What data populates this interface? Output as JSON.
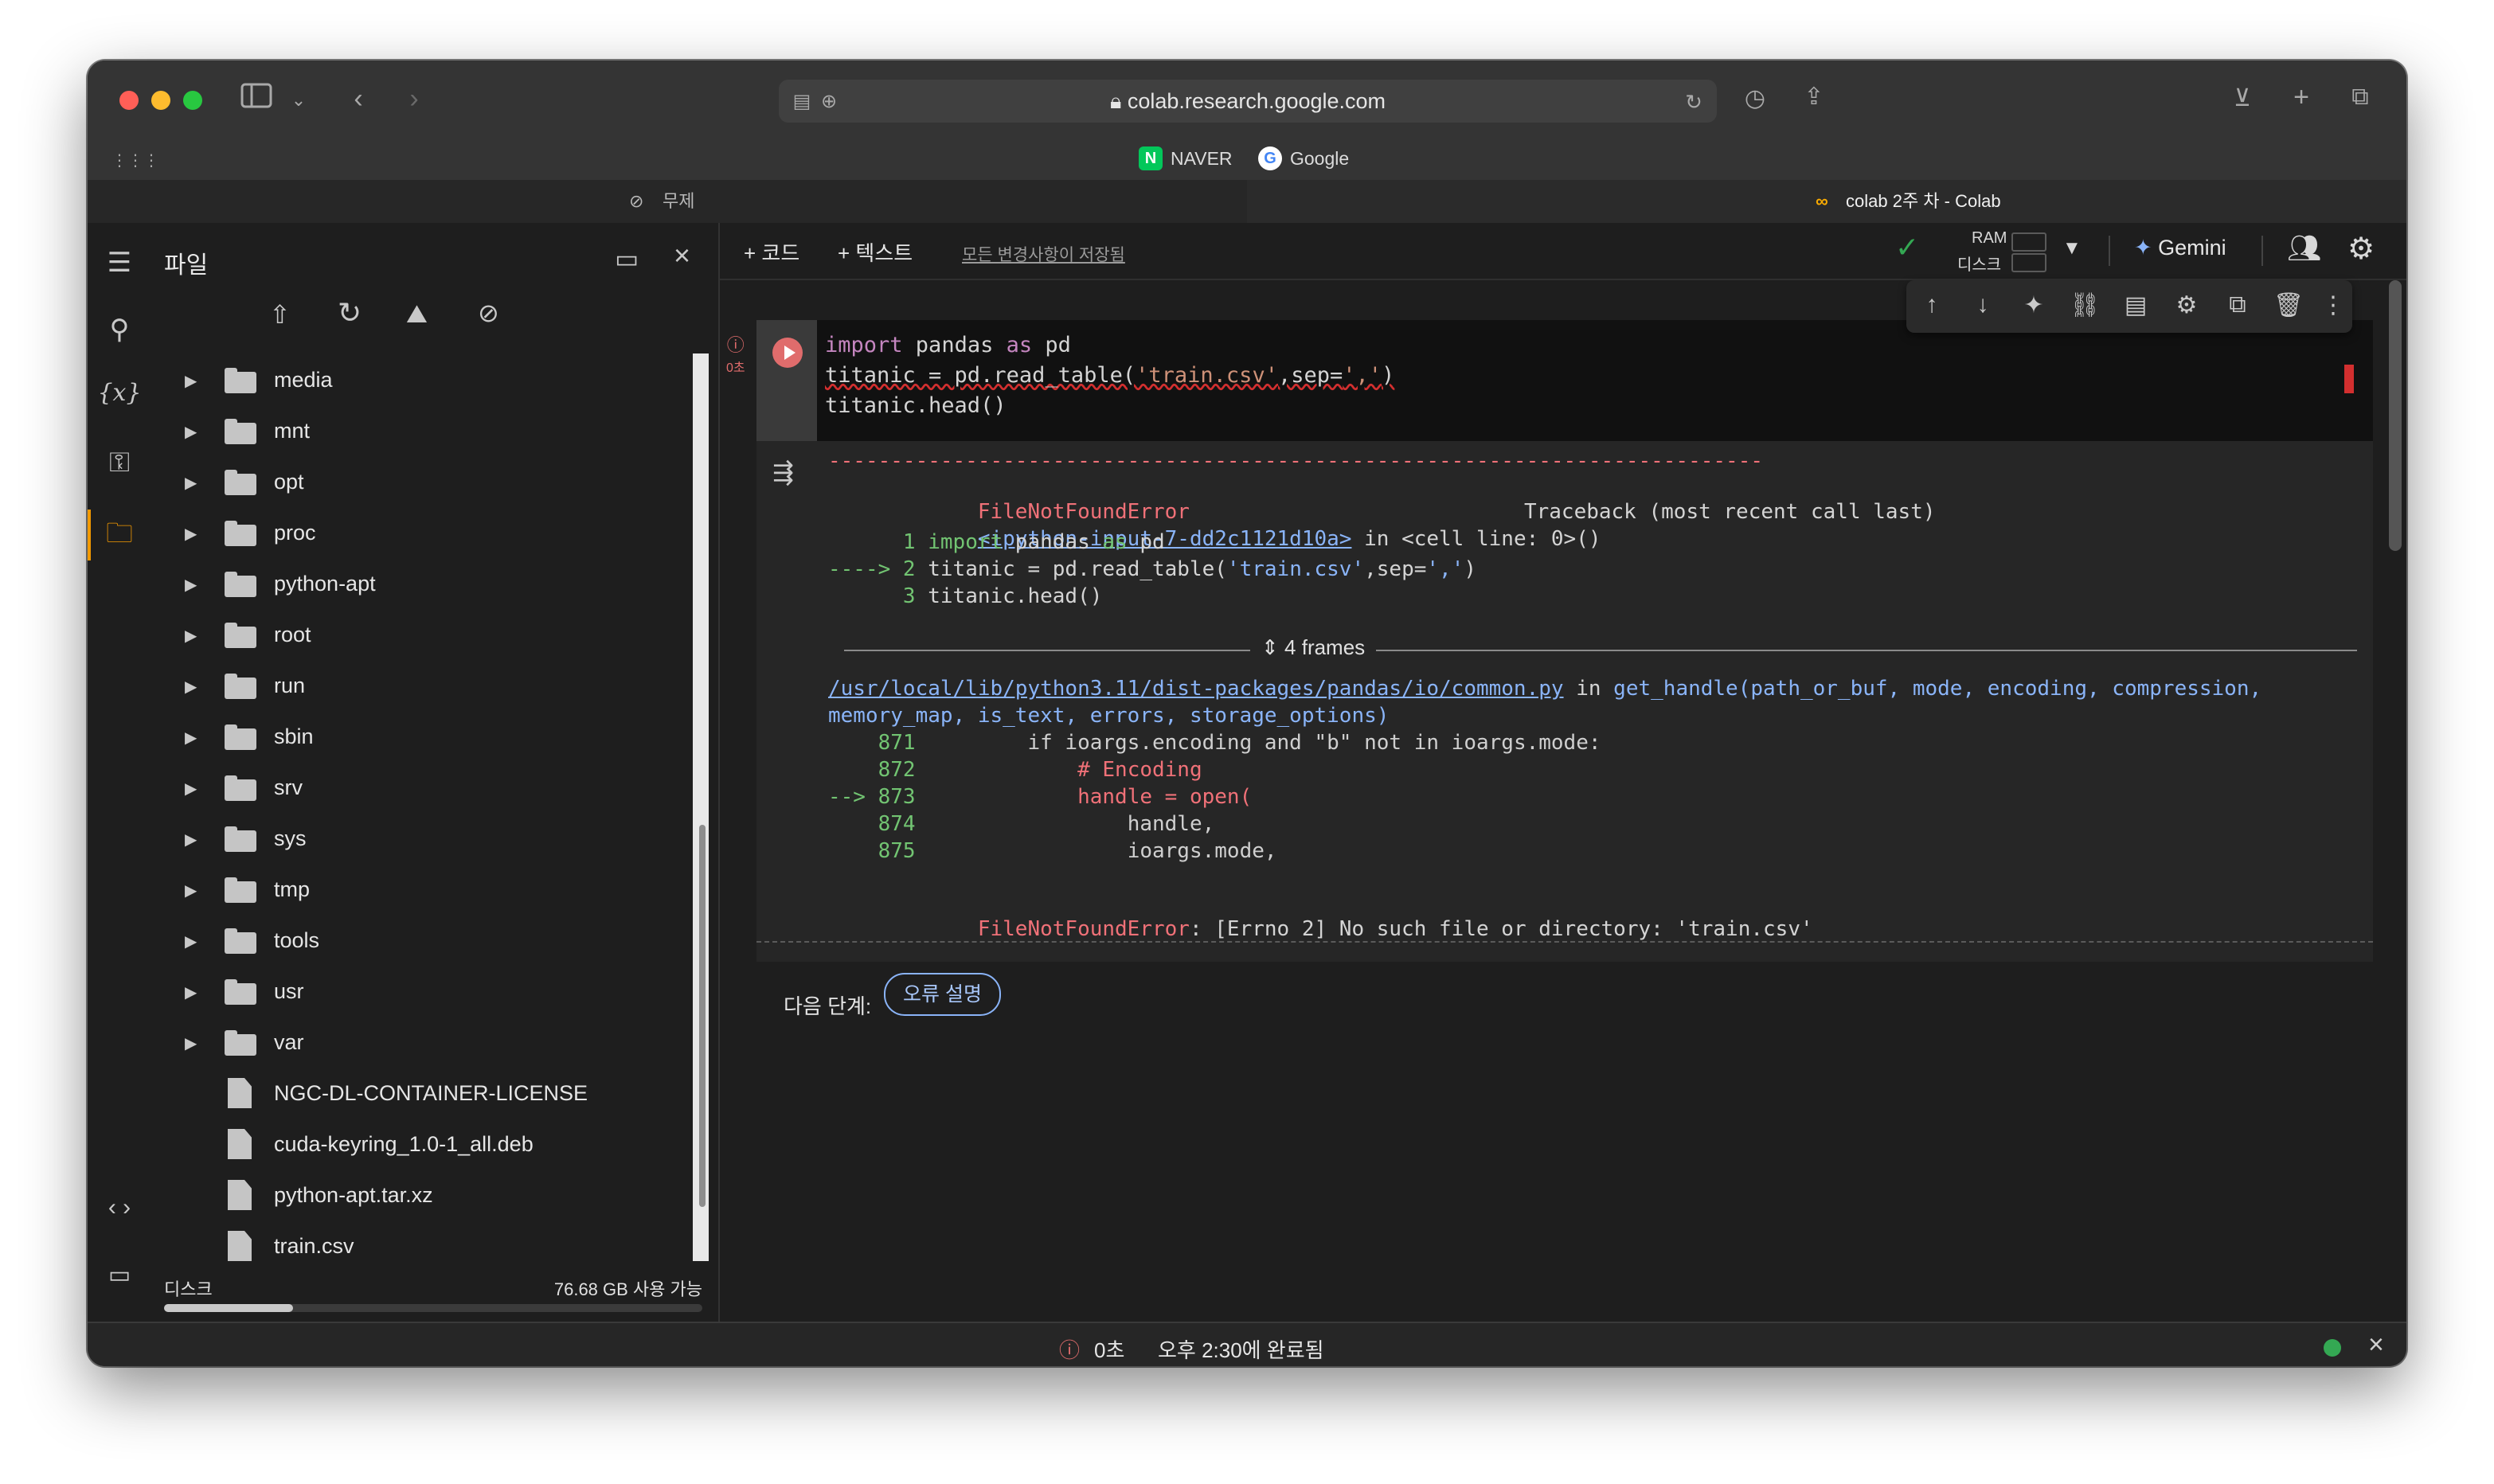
{
  "browser": {
    "url": "colab.research.google.com",
    "bookmarks": [
      {
        "label": "NAVER",
        "icon": "naver-icon",
        "color": "#03c75a"
      },
      {
        "label": "Google",
        "icon": "google-icon",
        "color": "#4285f4"
      }
    ],
    "tabs": [
      {
        "label": "무제",
        "active": false
      },
      {
        "label": "colab 2주 차 - Colab",
        "active": true
      }
    ]
  },
  "toolbar": {
    "add_code": "+ 코드",
    "add_text": "+ 텍스트",
    "saved_status": "모든 변경사항이 저장됨",
    "ram_label": "RAM",
    "disk_label": "디스크",
    "gemini_label": "Gemini"
  },
  "sidebar": {
    "title": "파일",
    "entries": [
      {
        "name": "media",
        "type": "folder"
      },
      {
        "name": "mnt",
        "type": "folder"
      },
      {
        "name": "opt",
        "type": "folder"
      },
      {
        "name": "proc",
        "type": "folder"
      },
      {
        "name": "python-apt",
        "type": "folder"
      },
      {
        "name": "root",
        "type": "folder"
      },
      {
        "name": "run",
        "type": "folder"
      },
      {
        "name": "sbin",
        "type": "folder"
      },
      {
        "name": "srv",
        "type": "folder"
      },
      {
        "name": "sys",
        "type": "folder"
      },
      {
        "name": "tmp",
        "type": "folder"
      },
      {
        "name": "tools",
        "type": "folder"
      },
      {
        "name": "usr",
        "type": "folder"
      },
      {
        "name": "var",
        "type": "folder"
      },
      {
        "name": "NGC-DL-CONTAINER-LICENSE",
        "type": "file"
      },
      {
        "name": "cuda-keyring_1.0-1_all.deb",
        "type": "file"
      },
      {
        "name": "python-apt.tar.xz",
        "type": "file"
      },
      {
        "name": "train.csv",
        "type": "file"
      }
    ],
    "disk_label": "디스크",
    "disk_available": "76.68 GB 사용 가능",
    "disk_usage_fraction": 0.24
  },
  "cell": {
    "exec_time": "0초",
    "code": {
      "line1": {
        "kw1": "import",
        "mid": " pandas ",
        "kw2": "as",
        "end": " pd"
      },
      "line2": {
        "pre": "titanic = pd.read_table(",
        "str1": "'train.csv'",
        "mid": ",sep=",
        "str2": "','",
        "post": ")"
      },
      "line3": "titanic.head()"
    }
  },
  "output": {
    "dashes": "---------------------------------------------------------------------------",
    "error_name": "FileNotFoundError",
    "traceback_header": "Traceback (most recent call last)",
    "input_link": "<ipython-input-7-dd2c1121d10a>",
    "in_cell": " in <cell line: 0>()",
    "line1": {
      "num": "      1 ",
      "kw": "import",
      "mid": " pandas ",
      "kw2": "as",
      "end": " pd"
    },
    "line2": {
      "arrow": "----> 2 ",
      "code": "titanic = pd.read_table(",
      "str1": "'train.csv'",
      "mid": ",sep=",
      "str2": "','",
      "post": ")"
    },
    "line3": {
      "num": "      3 ",
      "code": "titanic.head()"
    },
    "frames": "4 frames",
    "file_link": "/usr/local/lib/python3.11/dist-packages/pandas/io/common.py",
    "in_func": " in ",
    "func_sig1": "get_handle(path_or_buf, mode, encoding, compression,",
    "func_sig2": "memory_map, is_text, errors, storage_options)",
    "src": [
      {
        "num": "    871 ",
        "code": "        if ioargs.encoding and \"b\" not in ioargs.mode:"
      },
      {
        "num": "    872 ",
        "code": "            # Encoding"
      },
      {
        "num": "--> 873 ",
        "code": "            handle = open("
      },
      {
        "num": "    874 ",
        "code": "                handle,"
      },
      {
        "num": "    875 ",
        "code": "                ioargs.mode,"
      }
    ],
    "final_error_name": "FileNotFoundError",
    "final_error_msg": ": [Errno 2] No such file or directory: 'train.csv'",
    "next_step_label": "다음 단계:",
    "explain_button": "오류 설명"
  },
  "status": {
    "time": "0초",
    "completed": "오후 2:30에 완료됨"
  },
  "colors": {
    "accent_red": "#e06c6c",
    "link_blue": "#8ab4f8",
    "ok_green": "#34a853"
  }
}
